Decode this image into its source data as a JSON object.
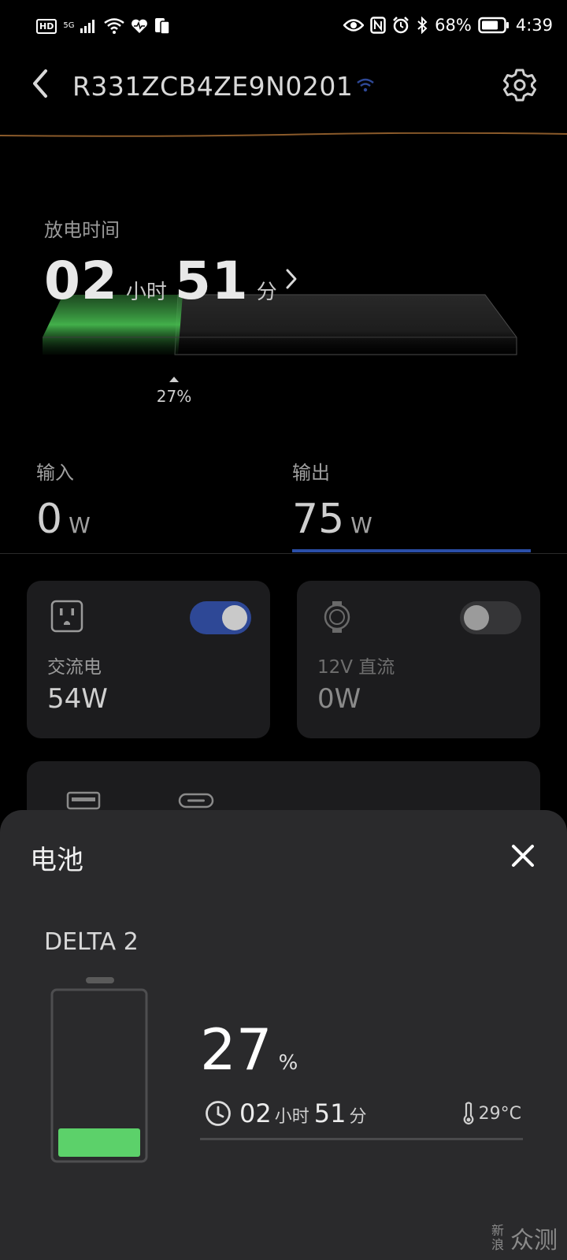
{
  "status_bar": {
    "hd": "HD",
    "network": "5G",
    "battery_pct": "68%",
    "time": "4:39"
  },
  "header": {
    "device_id": "R331ZCB4ZE9N0201"
  },
  "discharge": {
    "label": "放电时间",
    "hours": "02",
    "hours_unit": "小时",
    "minutes": "51",
    "minutes_unit": "分",
    "battery_percent_label": "27%",
    "battery_level": 27
  },
  "io": {
    "input_label": "输入",
    "input_value": "0",
    "input_unit": "W",
    "output_label": "输出",
    "output_value": "75",
    "output_unit": "W"
  },
  "cards": [
    {
      "label": "交流电",
      "value": "54W",
      "enabled": true
    },
    {
      "label": "12V 直流",
      "value": "0W",
      "enabled": false
    }
  ],
  "sheet": {
    "title": "电池",
    "model": "DELTA 2",
    "percent": "27",
    "percent_sym": "%",
    "hours": "02",
    "hours_unit": "小时",
    "minutes": "51",
    "minutes_unit": "分",
    "temperature": "29°C"
  },
  "watermark": {
    "small": "新浪",
    "big": "众测"
  },
  "colors": {
    "accent_blue": "#2e4896",
    "battery_green": "#5cd16a",
    "background": "#000000",
    "card": "#1c1c1e",
    "sheet": "#2a2a2c"
  }
}
